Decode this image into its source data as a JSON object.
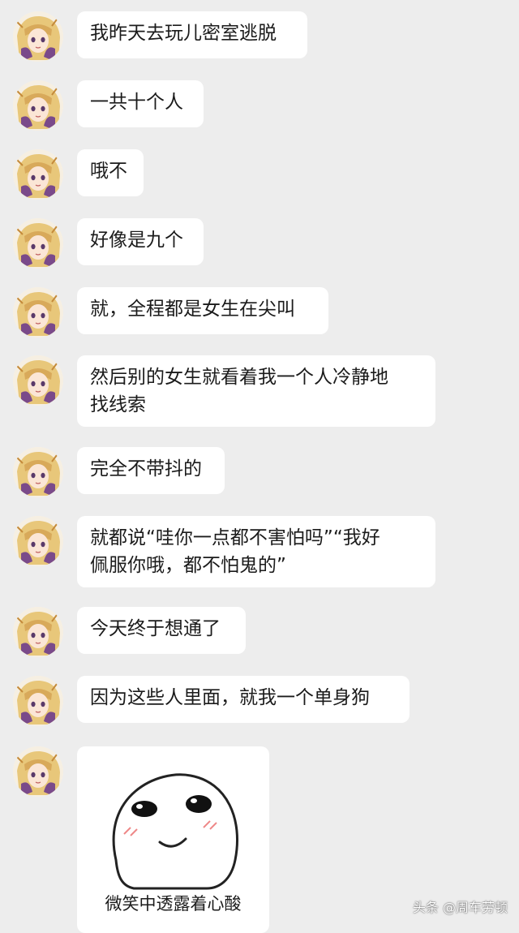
{
  "messages": [
    {
      "text": "我昨天去玩儿密室逃脱"
    },
    {
      "text": "一共十个人"
    },
    {
      "text": "哦不"
    },
    {
      "text": "好像是九个"
    },
    {
      "text": "就，全程都是女生在尖叫"
    },
    {
      "text": "然后别的女生就看着我一个人冷静地\n找线索"
    },
    {
      "text": "完全不带抖的"
    },
    {
      "text": "就都说“哇你一点都不害怕吗”“我好\n佩服你哦，都不怕鬼的”"
    },
    {
      "text": "今天终于想通了"
    },
    {
      "text": "因为这些人里面，就我一个单身狗"
    }
  ],
  "sticker": {
    "caption": "微笑中透露着心酸"
  },
  "watermark": {
    "text": "头条 @周车劳顿"
  },
  "colors": {
    "background": "#ededed",
    "bubble": "#ffffff",
    "text": "#1b1b1b"
  }
}
